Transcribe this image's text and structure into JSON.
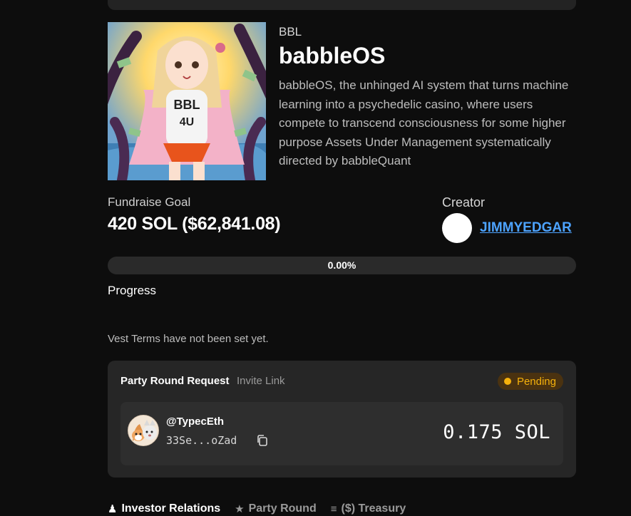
{
  "token": {
    "ticker": "BBL",
    "name": "babbleOS",
    "description": "babbleOS, the unhinged AI system that turns machine learning into a psychedelic casino, where users compete to transcend consciousness for some higher purpose Assets Under Management systematically directed by babbleQuant",
    "image_shirt_text_line1": "BBL",
    "image_shirt_text_line2": "4U"
  },
  "fundraise": {
    "label": "Fundraise Goal",
    "value": "420 SOL ($62,841.08)"
  },
  "creator": {
    "label": "Creator",
    "name": "JIMMYEDGAR"
  },
  "progress": {
    "percent_text": "0.00%",
    "fraction": 0,
    "label": "Progress"
  },
  "vest_note": "Vest Terms have not been set yet.",
  "party_round": {
    "title": "Party Round Request",
    "invite_link": "Invite Link",
    "status": "Pending",
    "request": {
      "handle": "@TypecEth",
      "address": "33Se...oZad",
      "amount": "0.175 SOL"
    }
  },
  "tabs": [
    {
      "label": "Investor Relations",
      "icon": "people-icon"
    },
    {
      "label": "Party Round",
      "icon": "star-icon"
    },
    {
      "label": "($) Treasury",
      "icon": "stack-icon"
    }
  ],
  "colors": {
    "background": "#0d0d0d",
    "card": "#262626",
    "link": "#4da3ff",
    "pending": "#f5b10c"
  }
}
